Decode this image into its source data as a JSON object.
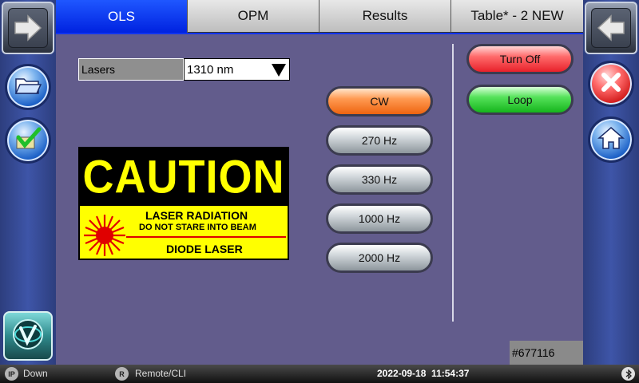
{
  "tabs": [
    {
      "label": "OLS",
      "active": true
    },
    {
      "label": "OPM",
      "active": false
    },
    {
      "label": "Results",
      "active": false
    },
    {
      "label": "Table* - 2 NEW",
      "active": false
    }
  ],
  "lasers": {
    "label": "Lasers",
    "value": "1310 nm"
  },
  "caution_sign": {
    "heading": "CAUTION",
    "line1": "LASER RADIATION",
    "line2": "DO NOT STARE INTO BEAM",
    "line3": "DIODE LASER"
  },
  "modulation_buttons": [
    {
      "label": "CW",
      "selected": true
    },
    {
      "label": "270 Hz",
      "selected": false
    },
    {
      "label": "330 Hz",
      "selected": false
    },
    {
      "label": "1000 Hz",
      "selected": false
    },
    {
      "label": "2000 Hz",
      "selected": false
    }
  ],
  "actions": {
    "turn_off": "Turn Off",
    "loop": "Loop"
  },
  "serial": "#677116",
  "status_bar": {
    "ip_icon": "IP",
    "network": "Down",
    "remote_icon": "R",
    "remote": "Remote/CLI",
    "datetime": "2022-09-18  11:54:37"
  },
  "icons": {
    "left_sidebar": [
      "forward-arrow-icon",
      "folder-open-icon",
      "save-check-icon",
      "brand-logo-icon"
    ],
    "right_sidebar": [
      "back-arrow-icon",
      "close-icon",
      "home-icon"
    ],
    "status_bar": [
      "ip-icon",
      "remote-icon",
      "bluetooth-icon"
    ]
  },
  "colors": {
    "active_tab": "#0022e0",
    "background": "#625c8c",
    "cw_selected": "#ff9a52",
    "turn_off": "#e8202a",
    "loop": "#15b41c"
  }
}
